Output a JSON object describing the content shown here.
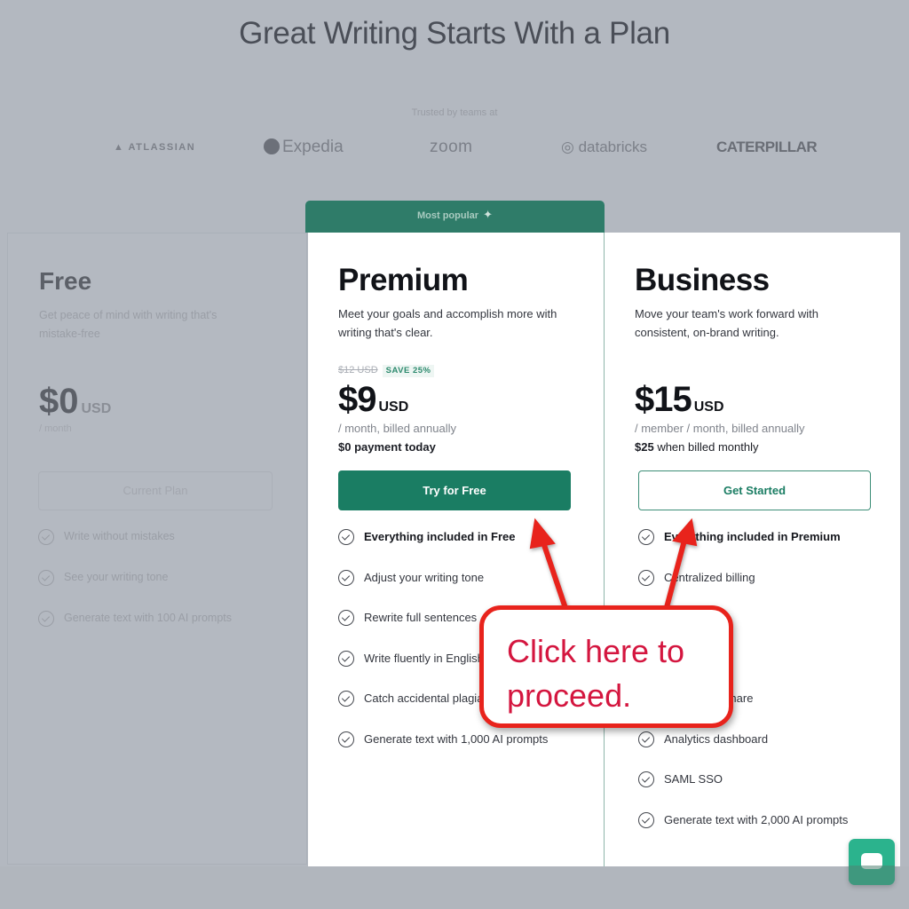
{
  "header": {
    "title": "Great Writing Starts With a Plan",
    "trusted_label": "Trusted by teams at",
    "logos": [
      "ATLASSIAN",
      "Expedia",
      "zoom",
      "databricks",
      "CATERPILLAR"
    ]
  },
  "plans": {
    "free": {
      "name": "Free",
      "description": "Get peace of mind with writing that's mistake-free",
      "price": "$0",
      "currency": "USD",
      "period": "/ month",
      "button_label": "Current Plan",
      "features": [
        "Write without mistakes",
        "See your writing tone",
        "Generate text with 100 AI prompts"
      ]
    },
    "premium": {
      "badge": "Most popular",
      "name": "Premium",
      "description": "Meet your goals and accomplish more with writing that's clear.",
      "old_price": "$12 USD",
      "save_label": "SAVE 25%",
      "price": "$9",
      "currency": "USD",
      "period": "/ month, billed annually",
      "extra": "$0 payment today",
      "button_label": "Try for Free",
      "features": [
        "Everything included in Free",
        "Adjust your writing tone",
        "Rewrite full sentences",
        "Write fluently in English",
        "Catch accidental plagiarism",
        "Generate text with 1,000 AI prompts"
      ]
    },
    "business": {
      "name": "Business",
      "description": "Move your team's work forward with consistent, on-brand writing.",
      "price": "$15",
      "currency": "USD",
      "period": "/ member / month, billed annually",
      "extra_bold": "$25",
      "extra_rest": " when billed monthly",
      "button_label": "Get Started",
      "features": [
        "Everything included in Premium",
        "Centralized billing",
        "",
        "",
        "Style guide share",
        "Analytics dashboard",
        "SAML SSO",
        "Generate text with 2,000 AI prompts"
      ]
    }
  },
  "annotation": {
    "line1": "Click here to",
    "line2": "proceed.",
    "color": "#e8231c"
  },
  "colors": {
    "brand_green": "#1a7d63",
    "banner_green": "#2f7c69",
    "chat_green": "#2bb38d"
  }
}
